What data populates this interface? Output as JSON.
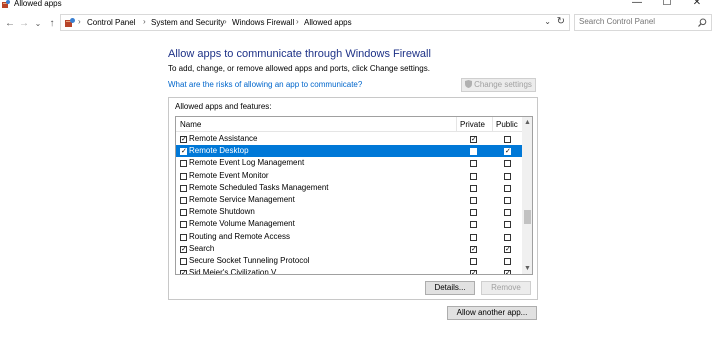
{
  "window": {
    "title": "Allowed apps",
    "minimize_glyph": "—",
    "maximize_glyph": "☐",
    "close_glyph": "✕"
  },
  "nav": {
    "back": "←",
    "forward": "→",
    "recent": "⌄",
    "up": "↑"
  },
  "breadcrumb": {
    "items": [
      "Control Panel",
      "System and Security",
      "Windows Firewall",
      "Allowed apps"
    ],
    "separator": "›",
    "dropdown": "⌄",
    "refresh": "↻"
  },
  "search": {
    "placeholder": "Search Control Panel"
  },
  "main": {
    "heading": "Allow apps to communicate through Windows Firewall",
    "subtext": "To add, change, or remove allowed apps and ports, click Change settings.",
    "risk_link": "What are the risks of allowing an app to communicate?",
    "change_settings_label": "Change settings"
  },
  "apps_group": {
    "label": "Allowed apps and features:",
    "columns": {
      "name": "Name",
      "private": "Private",
      "public": "Public"
    },
    "rows": [
      {
        "name": "Remote Assistance",
        "enabled": true,
        "private": true,
        "public": false,
        "selected": false
      },
      {
        "name": "Remote Desktop",
        "enabled": true,
        "private": false,
        "public": true,
        "selected": true
      },
      {
        "name": "Remote Event Log Management",
        "enabled": false,
        "private": false,
        "public": false,
        "selected": false
      },
      {
        "name": "Remote Event Monitor",
        "enabled": false,
        "private": false,
        "public": false,
        "selected": false
      },
      {
        "name": "Remote Scheduled Tasks Management",
        "enabled": false,
        "private": false,
        "public": false,
        "selected": false
      },
      {
        "name": "Remote Service Management",
        "enabled": false,
        "private": false,
        "public": false,
        "selected": false
      },
      {
        "name": "Remote Shutdown",
        "enabled": false,
        "private": false,
        "public": false,
        "selected": false
      },
      {
        "name": "Remote Volume Management",
        "enabled": false,
        "private": false,
        "public": false,
        "selected": false
      },
      {
        "name": "Routing and Remote Access",
        "enabled": false,
        "private": false,
        "public": false,
        "selected": false
      },
      {
        "name": "Search",
        "enabled": true,
        "private": true,
        "public": true,
        "selected": false
      },
      {
        "name": "Secure Socket Tunneling Protocol",
        "enabled": false,
        "private": false,
        "public": false,
        "selected": false
      },
      {
        "name": "Sid Meier's Civilization V",
        "enabled": true,
        "private": true,
        "public": true,
        "selected": false
      }
    ],
    "scroll_up": "▲",
    "scroll_down": "▼",
    "details_label": "Details...",
    "remove_label": "Remove"
  },
  "allow_another_label": "Allow another app...",
  "colors": {
    "heading": "#1e3287",
    "link": "#0066cc",
    "selection": "#0078d7"
  }
}
